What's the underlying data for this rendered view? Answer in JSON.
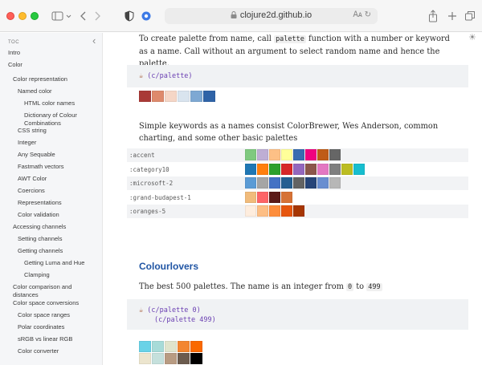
{
  "browser": {
    "url": "clojure2d.github.io",
    "icons": [
      "sidebar-toggle-icon",
      "back-icon",
      "forward-icon",
      "shield-icon",
      "extension-icon",
      "lock-icon",
      "translate-icon",
      "reload-icon",
      "share-icon",
      "new-tab-icon",
      "tab-overview-icon"
    ]
  },
  "sidebar": {
    "toc_label": "TOC",
    "items": [
      {
        "label": "Intro",
        "level": 0
      },
      {
        "label": "Color",
        "level": 0
      },
      {
        "label": "Color representation",
        "level": 1
      },
      {
        "label": "Named color",
        "level": 2
      },
      {
        "label": "HTML color names",
        "level": 3
      },
      {
        "label": "Dictionary of Colour Combinations",
        "level": 3
      },
      {
        "label": "CSS string",
        "level": 2
      },
      {
        "label": "Integer",
        "level": 2
      },
      {
        "label": "Any Sequable",
        "level": 2
      },
      {
        "label": "Fastmath vectors",
        "level": 2
      },
      {
        "label": "AWT Color",
        "level": 2
      },
      {
        "label": "Coercions",
        "level": 2
      },
      {
        "label": "Representations",
        "level": 2
      },
      {
        "label": "Color validation",
        "level": 2
      },
      {
        "label": "Accessing channels",
        "level": 1
      },
      {
        "label": "Setting channels",
        "level": 2
      },
      {
        "label": "Getting channels",
        "level": 2
      },
      {
        "label": "Getting Luma and Hue",
        "level": 3
      },
      {
        "label": "Clamping",
        "level": 3
      },
      {
        "label": "Color comparison and distances",
        "level": 1
      },
      {
        "label": "Color space conversions",
        "level": 1
      },
      {
        "label": "Color space ranges",
        "level": 2
      },
      {
        "label": "Polar coordinates",
        "level": 2
      },
      {
        "label": "sRGB vs linear RGB",
        "level": 2
      },
      {
        "label": "Color converter",
        "level": 2
      }
    ]
  },
  "content": {
    "intro_text_a": "To create palette from name, call ",
    "intro_code": "palette",
    "intro_text_b": " function with a number or keyword as a name. Call without an argument to select random name and hence the palette.",
    "code1": "(c/palette)",
    "palette_random": [
      "#a93a37",
      "#de8a6c",
      "#f5d6c6",
      "#d9e4ee",
      "#7ea8d3",
      "#2f63a7"
    ],
    "keywords_text": "Simple keywords as a names consist ColorBrewer, Wes Anderson, common charting, and some other basic palettes",
    "palettes": [
      {
        "name": ":accent",
        "colors": [
          "#7fc97f",
          "#beaed4",
          "#fdc086",
          "#ffff99",
          "#386cb0",
          "#f0027f",
          "#bf5b17",
          "#666666"
        ]
      },
      {
        "name": ":category10",
        "colors": [
          "#1f77b4",
          "#ff7f0e",
          "#2ca02c",
          "#d62728",
          "#9467bd",
          "#8c564b",
          "#e377c2",
          "#7f7f7f",
          "#bcbd22",
          "#17becf"
        ]
      },
      {
        "name": ":microsoft-2",
        "colors": [
          "#5b9bd5",
          "#a5a5a5",
          "#4472c4",
          "#255e91",
          "#636363",
          "#264478",
          "#698ed0",
          "#b7b7b7"
        ]
      },
      {
        "name": ":grand-budapest-1",
        "colors": [
          "#f1bb7b",
          "#fd6467",
          "#5b1a18",
          "#d67236"
        ]
      },
      {
        "name": ":oranges-5",
        "colors": [
          "#feedde",
          "#fdbe85",
          "#fd8d3c",
          "#e6550d",
          "#a63603"
        ]
      }
    ],
    "section_title": "Colourlovers",
    "best_text_a": "The best 500 palettes. The name is an integer from ",
    "best_code_from": "0",
    "best_text_b": " to ",
    "best_code_to": "499",
    "code2_line1": "(c/palette 0)",
    "code2_line2": "(c/palette 499)",
    "palette_zero": [
      "#69d2e7",
      "#a7dbd8",
      "#e0e4cc",
      "#f38630",
      "#fa6900"
    ],
    "palette_499": [
      "#ece5ce",
      "#c5e0dc",
      "#b89b82",
      "#6b5b4e",
      "#000000"
    ]
  }
}
